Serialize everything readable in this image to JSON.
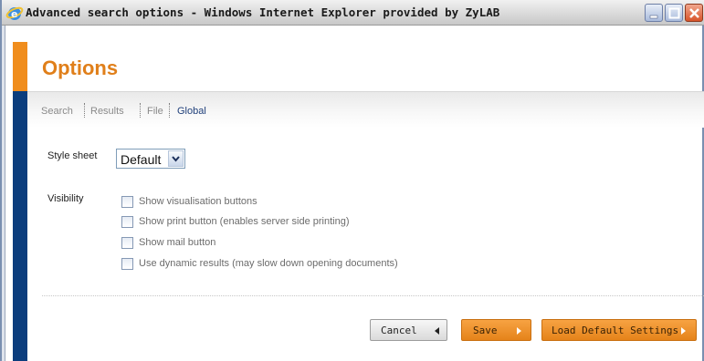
{
  "window": {
    "title": "Advanced search options - Windows Internet Explorer provided by ZyLAB"
  },
  "page": {
    "title": "Options"
  },
  "nav": {
    "items": [
      {
        "label": "Search",
        "active": false
      },
      {
        "label": "Results",
        "active": false
      },
      {
        "label": "File",
        "active": false
      },
      {
        "label": "Global",
        "active": true
      }
    ]
  },
  "form": {
    "style_sheet": {
      "label": "Style sheet",
      "selected": "Default"
    },
    "visibility": {
      "label": "Visibility",
      "options": [
        {
          "label": "Show visualisation buttons",
          "checked": false
        },
        {
          "label": "Show print button (enables server side printing)",
          "checked": false
        },
        {
          "label": "Show mail button",
          "checked": false
        },
        {
          "label": "Use dynamic results (may slow down opening documents)",
          "checked": false
        }
      ]
    }
  },
  "buttons": {
    "cancel": "Cancel",
    "save": "Save",
    "load_default": "Load Default Settings"
  },
  "colors": {
    "accent_orange": "#f08d1d",
    "accent_blue": "#0b3d7d",
    "title_orange": "#e07f1a",
    "active_nav": "#1f3f7a"
  }
}
